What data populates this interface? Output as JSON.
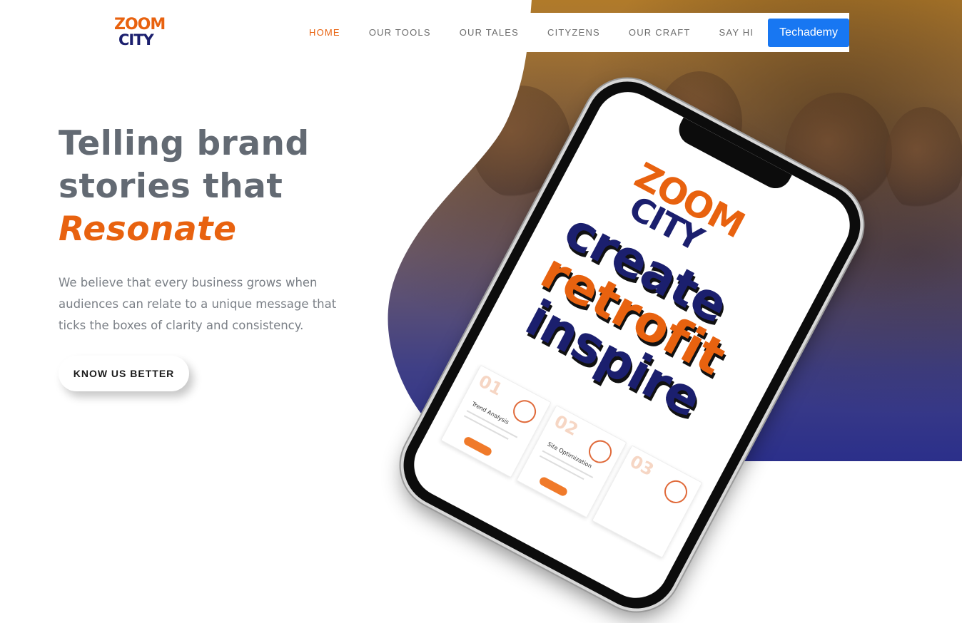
{
  "brand": {
    "logo_line1": "ZOOM",
    "logo_line2": "CITY",
    "accent_color": "#e8620f",
    "navy_color": "#1b1f6e"
  },
  "nav": {
    "items": [
      {
        "label": "HOME",
        "active": true
      },
      {
        "label": "OUR TOOLS"
      },
      {
        "label": "OUR TALES"
      },
      {
        "label": "CITYZENS"
      },
      {
        "label": "OUR CRAFT"
      },
      {
        "label": "SAY HI"
      }
    ],
    "cta_label": "Techademy",
    "cta_color": "#1877f2"
  },
  "hero": {
    "headline_line1": "Telling brand",
    "headline_line2": "stories that",
    "headline_accent": "Resonate",
    "lede": "We believe that every business grows when audiences can relate to a unique message that ticks the boxes of clarity and consistency.",
    "cta_label": "KNOW US BETTER"
  },
  "phone": {
    "screen_logo_line1": "ZOOM",
    "screen_logo_line2": "CITY",
    "word1": "create",
    "word2": "retrofit",
    "word3": "inspire",
    "cards": [
      {
        "num": "01",
        "title": "Trend Analysis"
      },
      {
        "num": "02",
        "title": "Site Optimization"
      },
      {
        "num": "03",
        "title": ""
      }
    ]
  }
}
